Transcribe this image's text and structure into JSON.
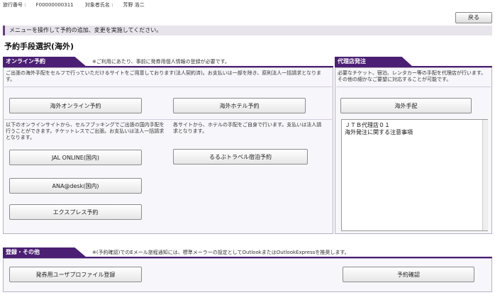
{
  "top_info": {
    "travel_no_label": "旅行番号 :",
    "travel_no": "F00000000311",
    "traveler_label": "対象者氏名 :",
    "traveler_name": "芳野 浩二"
  },
  "back_button": "戻る",
  "message": "メニューを操作して予約の追加、変更を実施してください。",
  "page_title": "予約手段選択(海外)",
  "online": {
    "header": "オンライン予約",
    "header_note": "※ご利用にあたり、事前に発券用個人情報の登録が必要です。",
    "desc1": "ご出張の海外手配をセルフで行っていただけるサイトをご用意しております(法人契約済)。お支払いは一部を除き、原則法人一括請求となります。",
    "btn_overseas_online": "海外オンライン予約",
    "btn_overseas_hotel": "海外ホテル予約",
    "desc2": "以下のオンラインサイトから、セルフブッキングでご出張の国内手配を行うことができます。チケットレスでご出張。お支払いは法人一括請求となります。",
    "desc3": "各サイトから、ホテルの手配をご自身で行います。支払いは法人請求となります。",
    "btn_jal": "JAL ONLINE(国内)",
    "btn_rurubu": "るるぶトラベル宿泊予約",
    "btn_ana": "ANA@desk(国内)",
    "btn_express": "エクスプレス予約"
  },
  "agency": {
    "header": "代理店発注",
    "desc": "必要なチケット、宿泊、レンタカー等の手配を代理店が行います。その他の細かなご要望に対応することが可能です。",
    "btn_overseas_arrange": "海外手配",
    "notes_line1": "ＪＴＢ代理店０１",
    "notes_line2": "海外発注に関する注意事項"
  },
  "registration": {
    "header": "登録・その他",
    "header_note": "※(予約確認)でのEメール旅程通知には、標準メーラーの設定としてOutlookまたはOutlookExpressを推奨します。",
    "btn_profile": "発券用ユーザプロファイル登録",
    "btn_confirm": "予約確認"
  },
  "colors": {
    "header_bg": "#4b1f73",
    "accent": "#6a3d86"
  }
}
